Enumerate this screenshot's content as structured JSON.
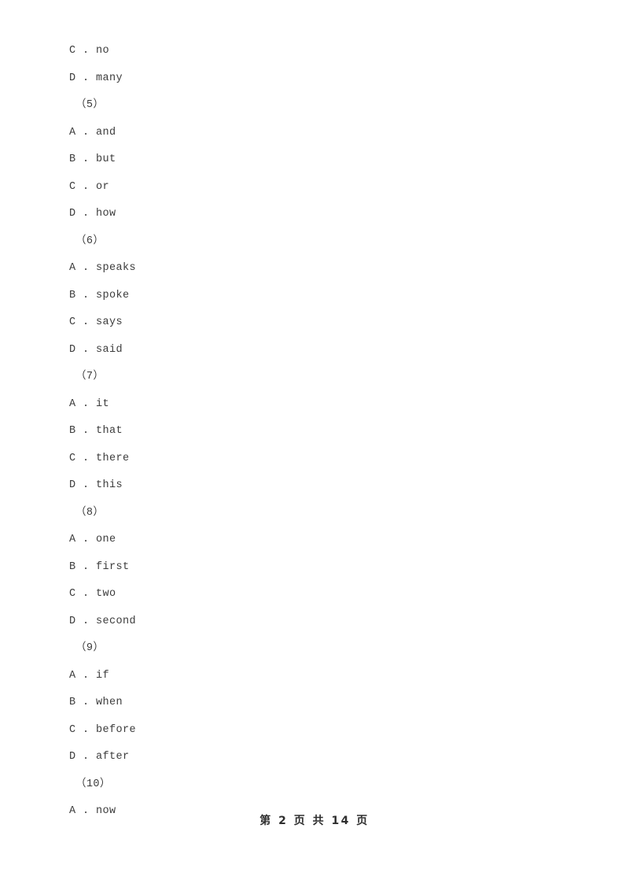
{
  "document": {
    "type": "exam-worksheet-page",
    "background_color": "#ffffff",
    "text_color": "#3c3c3c"
  },
  "body_lines": [
    {
      "kind": "option",
      "text": "C . no"
    },
    {
      "kind": "option",
      "text": "D . many"
    },
    {
      "kind": "qnum",
      "text": "（5）"
    },
    {
      "kind": "option",
      "text": "A . and"
    },
    {
      "kind": "option",
      "text": "B . but"
    },
    {
      "kind": "option",
      "text": "C . or"
    },
    {
      "kind": "option",
      "text": "D . how"
    },
    {
      "kind": "qnum",
      "text": "（6）"
    },
    {
      "kind": "option",
      "text": "A . speaks"
    },
    {
      "kind": "option",
      "text": "B . spoke"
    },
    {
      "kind": "option",
      "text": "C . says"
    },
    {
      "kind": "option",
      "text": "D . said"
    },
    {
      "kind": "qnum",
      "text": "（7）"
    },
    {
      "kind": "option",
      "text": "A . it"
    },
    {
      "kind": "option",
      "text": "B . that"
    },
    {
      "kind": "option",
      "text": "C . there"
    },
    {
      "kind": "option",
      "text": "D . this"
    },
    {
      "kind": "qnum",
      "text": "（8）"
    },
    {
      "kind": "option",
      "text": "A . one"
    },
    {
      "kind": "option",
      "text": "B . first"
    },
    {
      "kind": "option",
      "text": "C . two"
    },
    {
      "kind": "option",
      "text": "D . second"
    },
    {
      "kind": "qnum",
      "text": "（9）"
    },
    {
      "kind": "option",
      "text": "A . if"
    },
    {
      "kind": "option",
      "text": "B . when"
    },
    {
      "kind": "option",
      "text": "C . before"
    },
    {
      "kind": "option",
      "text": "D . after"
    },
    {
      "kind": "qnum",
      "text": "（10）"
    },
    {
      "kind": "option",
      "text": "A . now"
    }
  ],
  "footer": {
    "text": "第 2 页 共 14 页",
    "current_page": "2",
    "total_pages": "14"
  }
}
